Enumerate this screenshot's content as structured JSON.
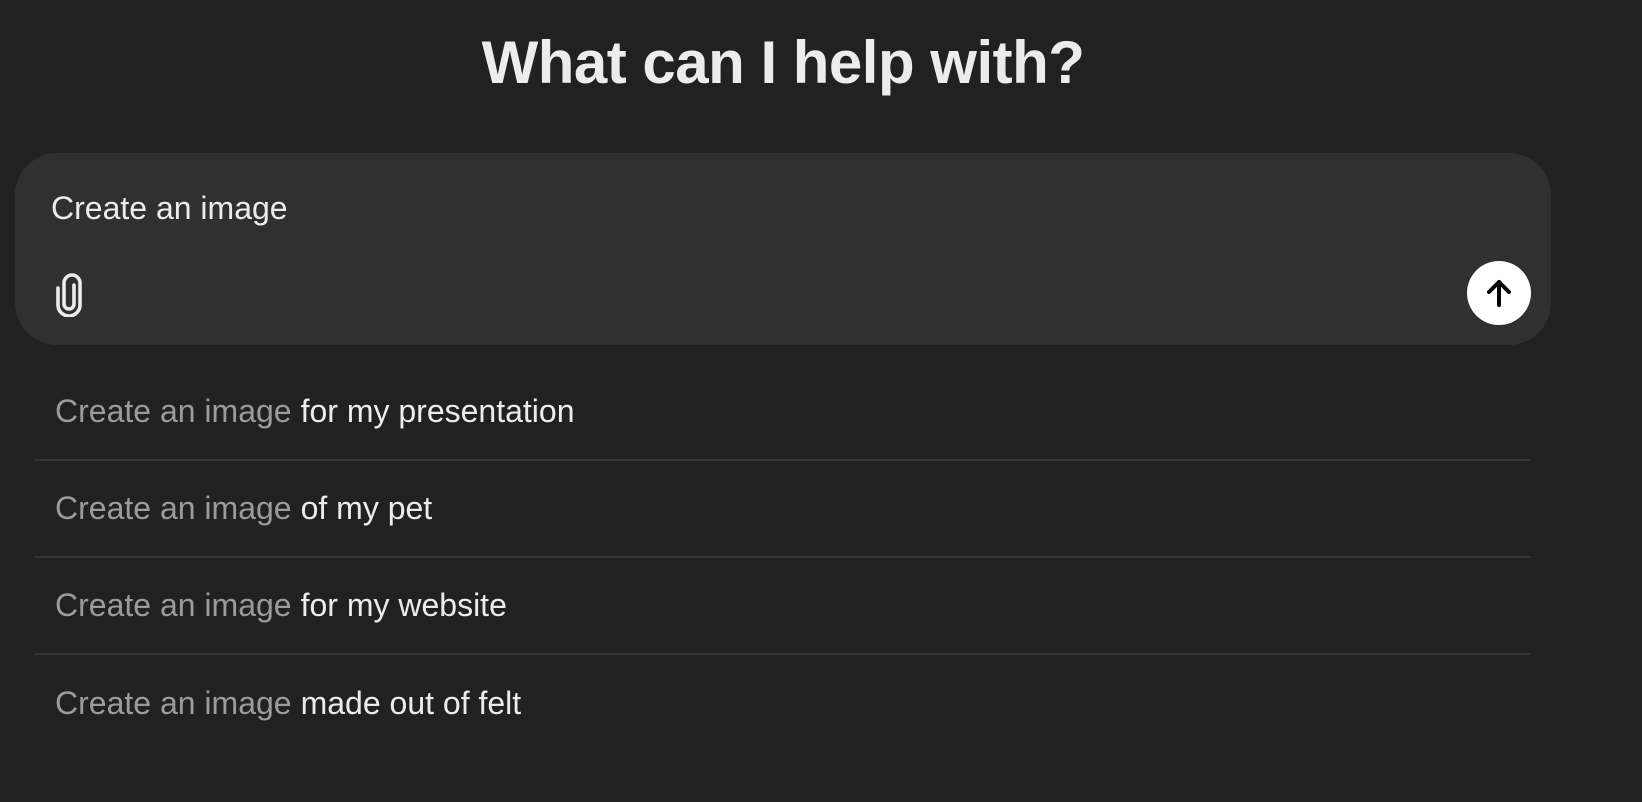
{
  "header": {
    "title": "What can I help with?"
  },
  "composer": {
    "input_value": "Create an image",
    "attach_icon": "paperclip-icon",
    "send_icon": "arrow-up-icon"
  },
  "suggestions": [
    {
      "prefix": "Create an image",
      "suffix": "for my presentation"
    },
    {
      "prefix": "Create an image",
      "suffix": "of my pet"
    },
    {
      "prefix": "Create an image",
      "suffix": "for my website"
    },
    {
      "prefix": "Create an image",
      "suffix": "made out of felt"
    }
  ],
  "colors": {
    "background": "#212121",
    "composer_background": "#303030",
    "text_primary": "#ececec",
    "text_muted": "#9b9b9b",
    "send_button": "#ffffff"
  }
}
